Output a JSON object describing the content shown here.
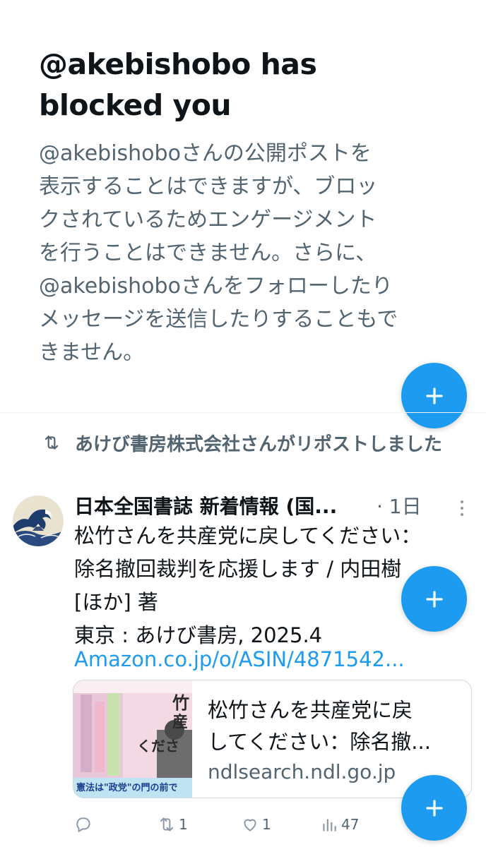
{
  "blocked": {
    "title_line1": "@akebishobo has",
    "title_line2": "blocked you",
    "body_lines": [
      "@akebishoboさんの公開ポストを",
      "表示することはできますが、ブロッ",
      "クされているためエンゲージメント",
      "を行うことはできません。さらに、",
      "@akebishoboさんをフォローしたり",
      "メッセージを送信したりすることもで",
      "きません。"
    ]
  },
  "repost": {
    "icon": "repost-icon",
    "text": "あけび書房株式会社さんがリポストしました"
  },
  "post": {
    "author": "日本全国書誌 新着情報 (国...",
    "time": "· 1日",
    "text_lines": [
      "松竹さんを共産党に戻してください：",
      "除名撤回裁判を応援します / 内田樹",
      "[ほか] 著",
      "東京 : あけび書房,  2025.4"
    ],
    "link": "Amazon.co.jp/o/ASIN/4871542...",
    "card": {
      "title_line1": "松竹さんを共産党に戻",
      "title_line2": "してください：除名撤...",
      "domain": "ndlsearch.ndl.go.jp",
      "thumb_caption": "憲法は\"政党\"の門の前で立ち止まるのか?",
      "thumb_title": "竹さんを産党にしてください"
    },
    "actions": {
      "reply_count": "",
      "repost_count": "1",
      "like_count": "1",
      "views_count": "47"
    }
  },
  "fab_icon": "plus-icon",
  "colors": {
    "accent": "#1d9bf0",
    "text": "#0f1419",
    "muted": "#536471",
    "border": "#cfd9de"
  }
}
